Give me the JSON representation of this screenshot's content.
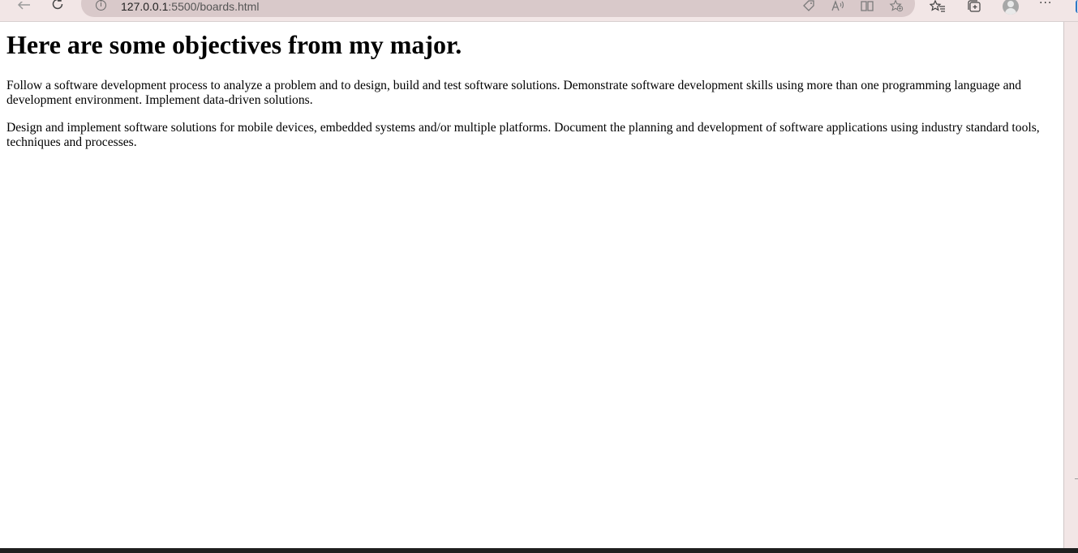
{
  "browser": {
    "url_host": "127.0.0.1",
    "url_path": ":5500/boards.html",
    "info_glyph": "i",
    "icons": {
      "back": "back-arrow-icon",
      "refresh": "refresh-icon",
      "site_info": "info-icon",
      "tag": "tag-icon",
      "read_aloud": "read-aloud-icon",
      "reader_view": "reader-view-icon",
      "add_favorite": "add-favorite-icon",
      "favorites": "favorites-icon",
      "collections": "collections-icon",
      "profile": "profile-avatar",
      "more": "more-options-icon"
    },
    "more_label": "···",
    "colors": {
      "toolbar_bg": "#f2e6e6",
      "address_bg": "#d9c9ca",
      "accent": "#2b78c8"
    }
  },
  "page": {
    "title": "Here are some objectives from my major.",
    "paragraphs": [
      "Follow a software development process to analyze a problem and to design, build and test software solutions. Demonstrate software development skills using more than one programming language and development environment. Implement data-driven solutions.",
      "Design and implement software solutions for mobile devices, embedded systems and/or multiple platforms. Document the planning and development of software applications using industry standard tools, techniques and processes."
    ]
  }
}
